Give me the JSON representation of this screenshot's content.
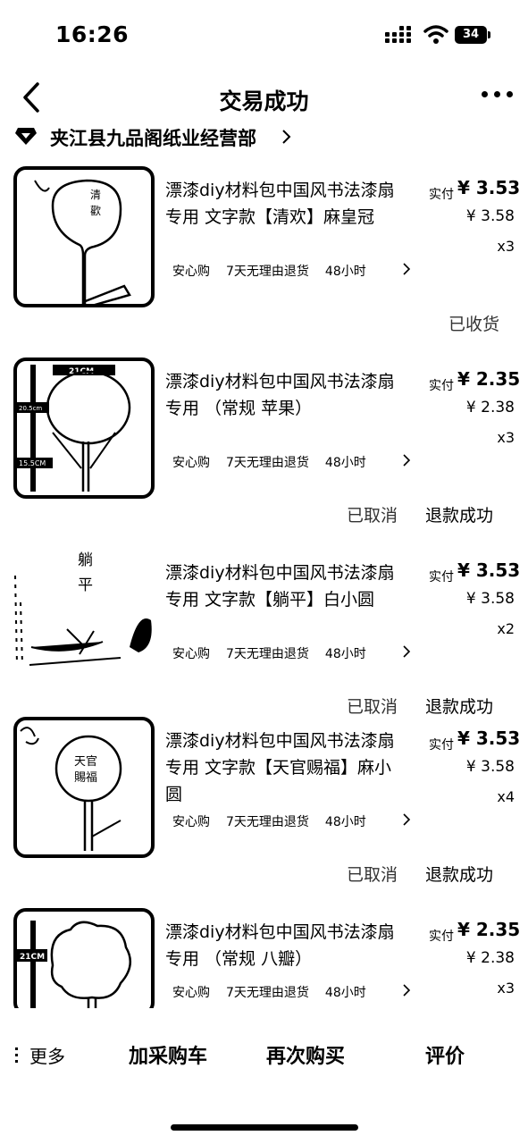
{
  "status_bar": {
    "time": "16:26",
    "battery": "34"
  },
  "nav": {
    "title": "交易成功"
  },
  "shop": {
    "name": "夹江县九品阁纸业经营部"
  },
  "items": [
    {
      "title": "漂漆diy材料包中国风书法漆扇专用 文字款【清欢】麻皇冠",
      "paid_label": "实付",
      "paid": "¥ 3.53",
      "original": "¥ 3.58",
      "qty": "x3",
      "tags": [
        "安心购",
        "7天无理由退货",
        "48小时"
      ],
      "status": "已收货",
      "refund": ""
    },
    {
      "title": "漂漆diy材料包中国风书法漆扇专用 （常规 苹果）",
      "paid_label": "实付",
      "paid": "¥ 2.35",
      "original": "¥ 2.38",
      "qty": "x3",
      "tags": [
        "安心购",
        "7天无理由退货",
        "48小时"
      ],
      "status": "已取消",
      "refund": "退款成功",
      "thumb_labels": [
        "21CM",
        "20.5cm",
        "15.5CM"
      ]
    },
    {
      "title": "漂漆diy材料包中国风书法漆扇专用 文字款【躺平】白小圆",
      "paid_label": "实付",
      "paid": "¥ 3.53",
      "original": "¥ 3.58",
      "qty": "x2",
      "tags": [
        "安心购",
        "7天无理由退货",
        "48小时"
      ],
      "status": "已取消",
      "refund": "退款成功"
    },
    {
      "title": "漂漆diy材料包中国风书法漆扇专用 文字款【天官赐福】麻小圆",
      "paid_label": "实付",
      "paid": "¥ 3.53",
      "original": "¥ 3.58",
      "qty": "x4",
      "tags": [
        "安心购",
        "7天无理由退货",
        "48小时"
      ],
      "status": "已取消",
      "refund": "退款成功"
    },
    {
      "title": "漂漆diy材料包中国风书法漆扇专用 （常规 八瓣）",
      "paid_label": "实付",
      "paid": "¥ 2.35",
      "original": "¥ 2.38",
      "qty": "x3",
      "tags": [
        "安心购",
        "7天无理由退货",
        "48小时"
      ],
      "thumb_labels": [
        "21CM"
      ]
    }
  ],
  "bottom": {
    "more": "更多",
    "add_cart": "加采购车",
    "buy_again": "再次购买",
    "review": "评价"
  }
}
